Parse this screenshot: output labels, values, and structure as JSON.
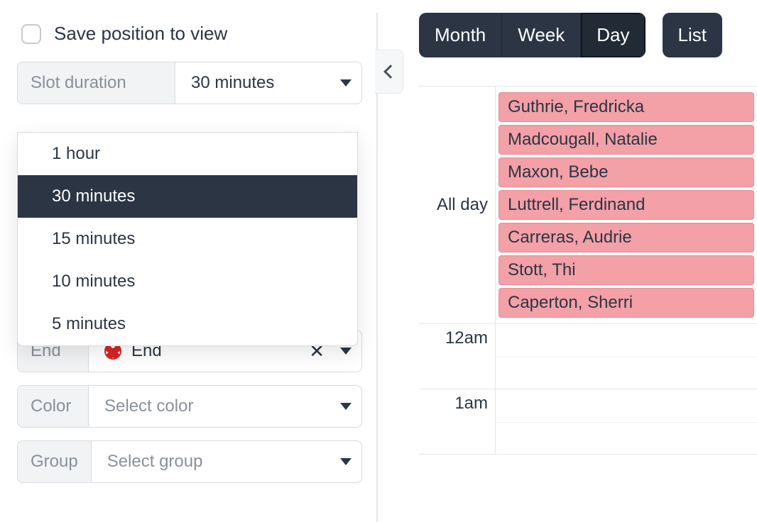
{
  "left": {
    "save_label": "Save position to view",
    "slot_duration": {
      "label": "Slot duration",
      "value": "30 minutes",
      "options": [
        "1 hour",
        "30 minutes",
        "15 minutes",
        "10 minutes",
        "5 minutes"
      ],
      "selected_index": 1
    },
    "end": {
      "label": "End",
      "value": "End"
    },
    "color": {
      "label": "Color",
      "placeholder": "Select color"
    },
    "group": {
      "label": "Group",
      "placeholder": "Select group"
    }
  },
  "toolbar": {
    "views": [
      "Month",
      "Week",
      "Day"
    ],
    "active_index": 2,
    "list": "List"
  },
  "calendar": {
    "allday_label": "All day",
    "allday_events": [
      "Guthrie, Fredricka",
      "Madcougall, Natalie",
      "Maxon, Bebe",
      "Luttrell, Ferdinand",
      "Carreras, Audrie",
      "Stott, Thi",
      "Caperton, Sherri"
    ],
    "slots": [
      "12am",
      "1am"
    ]
  }
}
